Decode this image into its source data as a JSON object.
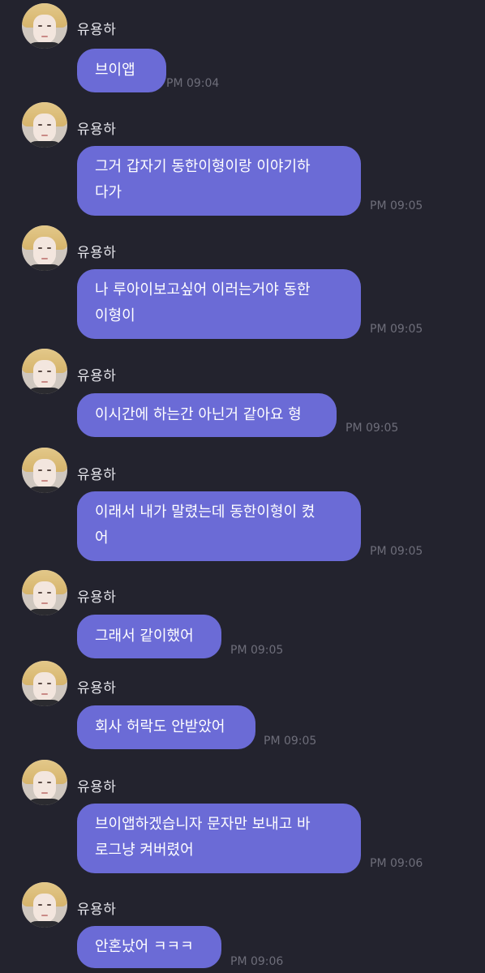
{
  "sender_name": "유용하",
  "messages": [
    {
      "text": "브이앱",
      "time": "PM 09:04"
    },
    {
      "text": "그거 갑자기 동한이형이랑 이야기하\n다가",
      "time": "PM 09:05"
    },
    {
      "text": "나 루아이보고싶어 이러는거야 동한\n이형이",
      "time": "PM 09:05"
    },
    {
      "text": "이시간에 하는간 아닌거 같아요 형",
      "time": "PM 09:05"
    },
    {
      "text": "이래서 내가 말렸는데 동한이형이 켰\n어",
      "time": "PM 09:05"
    },
    {
      "text": "그래서 같이했어",
      "time": "PM 09:05"
    },
    {
      "text": "회사 허락도 안받았어",
      "time": "PM 09:05"
    },
    {
      "text": "브이앱하겠습니자 문자만 보내고 바\n로그냥 켜버렸어",
      "time": "PM 09:06"
    },
    {
      "text": "안혼났어 ㅋㅋㅋ",
      "time": "PM 09:06"
    }
  ]
}
